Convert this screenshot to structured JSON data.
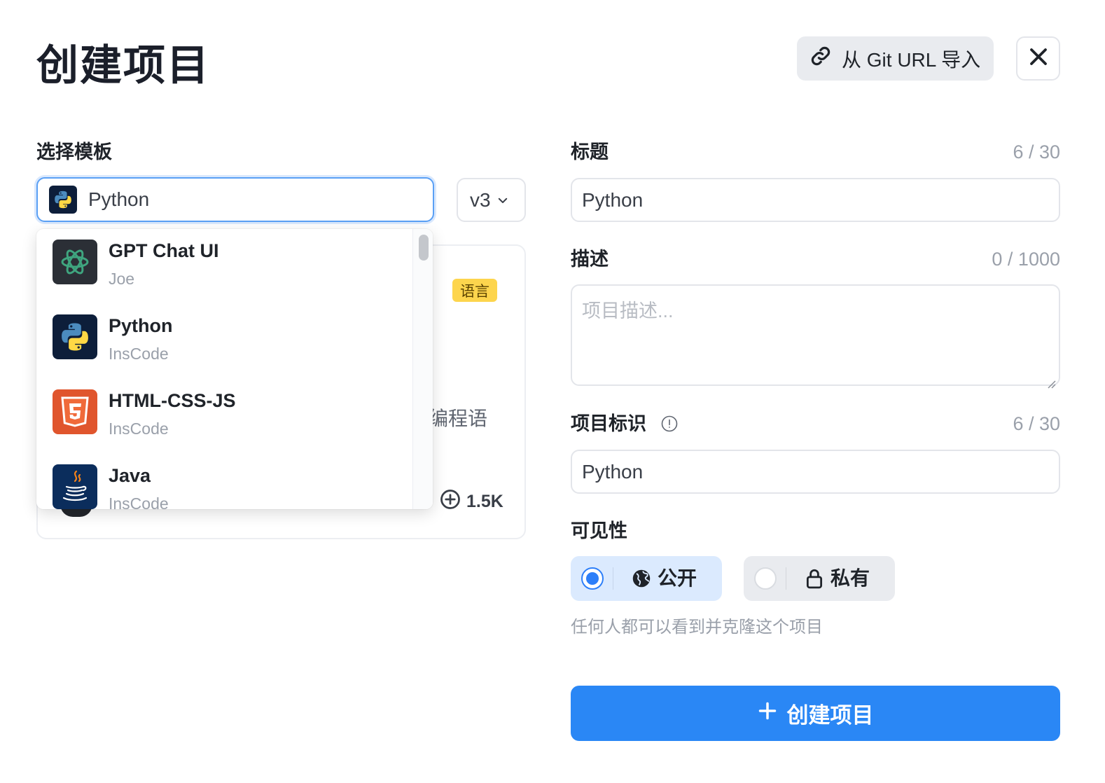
{
  "header": {
    "title": "创建项目",
    "git_import_label": "从 Git URL 导入"
  },
  "template": {
    "label": "选择模板",
    "selected": "Python",
    "version": "v3",
    "dropdown_items": [
      {
        "name": "GPT Chat UI",
        "author": "Joe",
        "icon": "openai-icon"
      },
      {
        "name": "Python",
        "author": "InsCode",
        "icon": "python-icon"
      },
      {
        "name": "HTML-CSS-JS",
        "author": "InsCode",
        "icon": "html5-icon"
      },
      {
        "name": "Java",
        "author": "InsCode",
        "icon": "java-icon"
      }
    ],
    "card": {
      "badge": "语言",
      "desc_fragment": "编程语",
      "forks": "1.5K"
    }
  },
  "form": {
    "title_label": "标题",
    "title_counter": "6 / 30",
    "title_value": "Python",
    "desc_label": "描述",
    "desc_counter": "0 / 1000",
    "desc_placeholder": "项目描述...",
    "id_label": "项目标识",
    "id_counter": "6 / 30",
    "id_value": "Python",
    "visibility_label": "可见性",
    "visibility_public": "公开",
    "visibility_private": "私有",
    "visibility_selected": "public",
    "visibility_hint": "任何人都可以看到并克隆这个项目",
    "submit_label": "创建项目"
  },
  "colors": {
    "primary": "#2a87f5",
    "badge": "#fdd54d",
    "public_bg": "#dbeafe"
  }
}
